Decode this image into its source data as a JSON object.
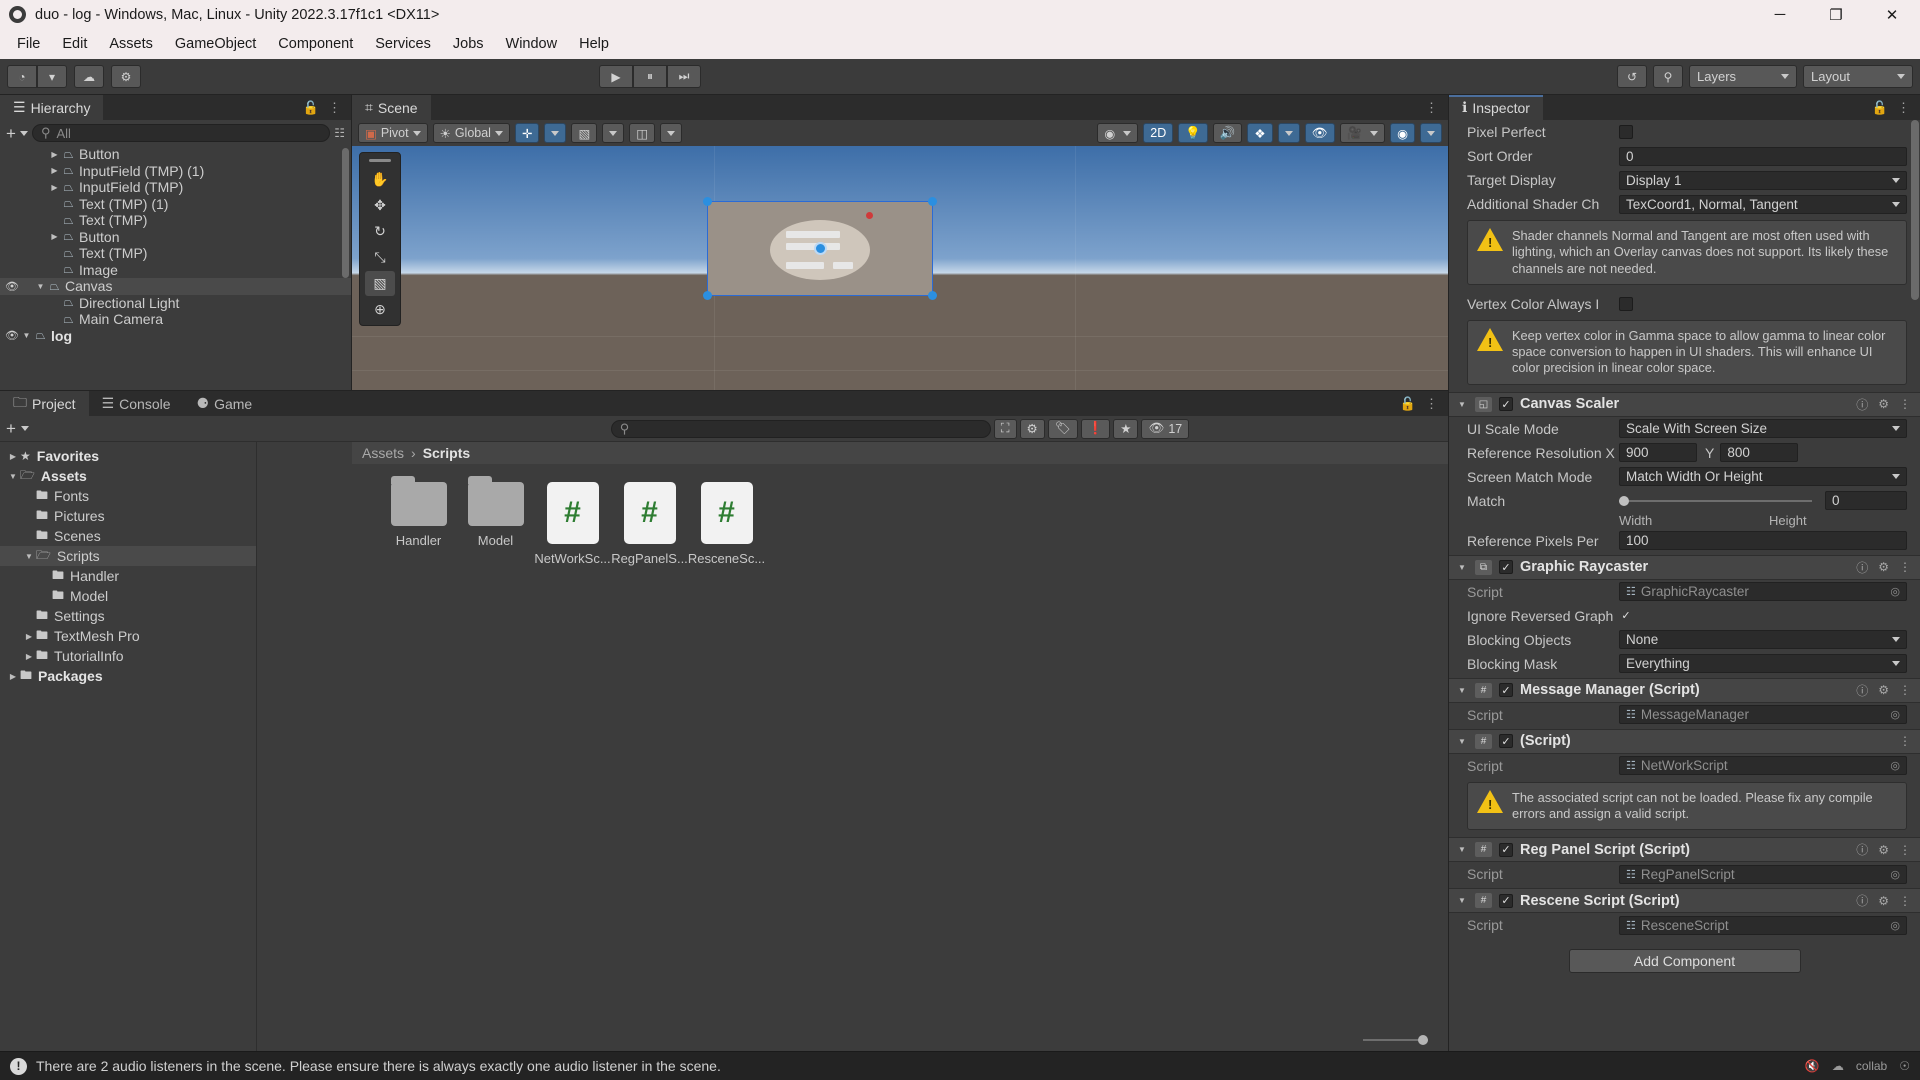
{
  "window": {
    "title": "duo - log - Windows, Mac, Linux - Unity 2022.3.17f1c1 <DX11>",
    "minimize": "─",
    "maximize": "❐",
    "close": "✕"
  },
  "menubar": {
    "items": [
      "File",
      "Edit",
      "Assets",
      "GameObject",
      "Component",
      "Services",
      "Jobs",
      "Window",
      "Help"
    ]
  },
  "toolbar": {
    "account_icon": "◔",
    "cloud_icon": "☁",
    "settings_icon": "⚙",
    "play": "▶",
    "pause": "⏸",
    "step": "⏭",
    "history_icon": "↺",
    "search_icon": "⚲",
    "layers_label": "Layers",
    "layout_label": "Layout"
  },
  "hierarchy": {
    "tab_label": "Hierarchy",
    "tab_icon": "☰",
    "search_placeholder": "All",
    "plus_label": "+",
    "items": [
      {
        "label": "log",
        "depth": 0,
        "expanded": true,
        "bold": true,
        "eye": true,
        "hasArrow": true,
        "selected": false
      },
      {
        "label": "Main Camera",
        "depth": 2,
        "expanded": false,
        "bold": false,
        "eye": false,
        "hasArrow": false,
        "selected": false
      },
      {
        "label": "Directional Light",
        "depth": 2,
        "expanded": false,
        "bold": false,
        "eye": false,
        "hasArrow": false,
        "selected": false
      },
      {
        "label": "Canvas",
        "depth": 1,
        "expanded": true,
        "bold": false,
        "eye": true,
        "hasArrow": true,
        "selected": true
      },
      {
        "label": "Image",
        "depth": 2,
        "expanded": false,
        "bold": false,
        "eye": false,
        "hasArrow": false,
        "selected": false
      },
      {
        "label": "Text (TMP)",
        "depth": 2,
        "expanded": false,
        "bold": false,
        "eye": false,
        "hasArrow": false,
        "selected": false
      },
      {
        "label": "Button",
        "depth": 2,
        "expanded": false,
        "bold": false,
        "eye": false,
        "hasArrow": true,
        "selected": false
      },
      {
        "label": "Text (TMP)",
        "depth": 2,
        "expanded": false,
        "bold": false,
        "eye": false,
        "hasArrow": false,
        "selected": false
      },
      {
        "label": "Text (TMP) (1)",
        "depth": 2,
        "expanded": false,
        "bold": false,
        "eye": false,
        "hasArrow": false,
        "selected": false
      },
      {
        "label": "InputField (TMP)",
        "depth": 2,
        "expanded": false,
        "bold": false,
        "eye": false,
        "hasArrow": true,
        "selected": false
      },
      {
        "label": "InputField (TMP) (1)",
        "depth": 2,
        "expanded": false,
        "bold": false,
        "eye": false,
        "hasArrow": true,
        "selected": false
      },
      {
        "label": "Button",
        "depth": 2,
        "expanded": false,
        "bold": false,
        "eye": false,
        "hasArrow": true,
        "selected": false
      }
    ]
  },
  "scene": {
    "tab_label": "Scene",
    "tab_icon": "⌗",
    "pivot_label": "Pivot",
    "global_label": "Global",
    "mode_2d": "2D",
    "toolbuttons": [
      "☷",
      "⌗",
      "≡"
    ],
    "tools": [
      "✋",
      "✥",
      "↻",
      "⤡",
      "▧",
      "⊕"
    ]
  },
  "project": {
    "tabs": [
      {
        "label": "Project",
        "icon": "🗀",
        "active": true
      },
      {
        "label": "Console",
        "icon": "☰",
        "active": false
      },
      {
        "label": "Game",
        "icon": "⚈",
        "active": false
      }
    ],
    "breadcrumb": {
      "root": "Assets",
      "sep": "›",
      "current": "Scripts"
    },
    "search_placeholder": "",
    "counter_badge": "17",
    "tree": [
      {
        "label": "Favorites",
        "depth": 0,
        "icon": "★",
        "arrow": "collapsed",
        "bold": true,
        "selected": false
      },
      {
        "label": "Assets",
        "depth": 0,
        "icon": "🗁",
        "arrow": "expanded",
        "bold": true,
        "selected": false
      },
      {
        "label": "Fonts",
        "depth": 1,
        "icon": "🖿",
        "arrow": "none",
        "bold": false,
        "selected": false
      },
      {
        "label": "Pictures",
        "depth": 1,
        "icon": "🖿",
        "arrow": "none",
        "bold": false,
        "selected": false
      },
      {
        "label": "Scenes",
        "depth": 1,
        "icon": "🖿",
        "arrow": "none",
        "bold": false,
        "selected": false
      },
      {
        "label": "Scripts",
        "depth": 1,
        "icon": "🗁",
        "arrow": "expanded",
        "bold": false,
        "selected": true
      },
      {
        "label": "Handler",
        "depth": 2,
        "icon": "🖿",
        "arrow": "none",
        "bold": false,
        "selected": false
      },
      {
        "label": "Model",
        "depth": 2,
        "icon": "🖿",
        "arrow": "none",
        "bold": false,
        "selected": false
      },
      {
        "label": "Settings",
        "depth": 1,
        "icon": "🖿",
        "arrow": "none",
        "bold": false,
        "selected": false
      },
      {
        "label": "TextMesh Pro",
        "depth": 1,
        "icon": "🖿",
        "arrow": "collapsed",
        "bold": false,
        "selected": false
      },
      {
        "label": "TutorialInfo",
        "depth": 1,
        "icon": "🖿",
        "arrow": "collapsed",
        "bold": false,
        "selected": false
      },
      {
        "label": "Packages",
        "depth": 0,
        "icon": "🖿",
        "arrow": "collapsed",
        "bold": true,
        "selected": false
      }
    ],
    "assets": [
      {
        "name": "Handler",
        "type": "folder"
      },
      {
        "name": "Model",
        "type": "folder"
      },
      {
        "name": "NetWorkSc...",
        "type": "script",
        "glyph": "#"
      },
      {
        "name": "RegPanelS...",
        "type": "script",
        "glyph": "#"
      },
      {
        "name": "ResceneSc...",
        "type": "script",
        "glyph": "#"
      }
    ]
  },
  "inspector": {
    "tab_label": "Inspector",
    "tab_icon": "ℹ",
    "canvas_fields": [
      {
        "label": "Pixel Perfect",
        "value": "",
        "kind": "partial"
      },
      {
        "label": "Sort Order",
        "value": "0",
        "kind": "text"
      },
      {
        "label": "Target Display",
        "value": "Display 1",
        "kind": "dropdown"
      },
      {
        "label": "Additional Shader Ch",
        "value": "TexCoord1, Normal, Tangent",
        "kind": "dropdown"
      }
    ],
    "warning_1": "Shader channels Normal and Tangent are most often used with lighting, which an Overlay canvas does not support. Its likely these channels are not needed.",
    "vertex_color_label": "Vertex Color Always I",
    "warning_2": "Keep vertex color in Gamma space to allow gamma to linear color space conversion to happen in UI shaders. This will enhance UI color precision in linear color space.",
    "components": [
      {
        "title": "Canvas Scaler",
        "icon": "◱",
        "checked": true,
        "has_help": true,
        "rows": [
          {
            "label": "UI Scale Mode",
            "value": "Scale With Screen Size",
            "kind": "dropdown"
          },
          {
            "label": "Reference Resolution X",
            "value": "900",
            "kind": "xy",
            "y_label": "Y",
            "y_value": "800"
          },
          {
            "label": "Screen Match Mode",
            "value": "Match Width Or Height",
            "kind": "dropdown"
          },
          {
            "label": "Match",
            "value": "0",
            "kind": "slider",
            "width_label": "Width",
            "height_label": "Height"
          },
          {
            "label": "Reference Pixels Per",
            "value": "100",
            "kind": "text"
          }
        ]
      },
      {
        "title": "Graphic Raycaster",
        "icon": "⧉",
        "checked": true,
        "has_help": true,
        "rows": [
          {
            "label": "Script",
            "value": "GraphicRaycaster",
            "kind": "object"
          },
          {
            "label": "Ignore Reversed Graph",
            "value": "",
            "kind": "checkbox",
            "checked": true
          },
          {
            "label": "Blocking Objects",
            "value": "None",
            "kind": "dropdown"
          },
          {
            "label": "Blocking Mask",
            "value": "Everything",
            "kind": "dropdown"
          }
        ]
      },
      {
        "title": "Message Manager (Script)",
        "icon": "#",
        "checked": true,
        "has_help": true,
        "rows": [
          {
            "label": "Script",
            "value": "MessageManager",
            "kind": "object"
          }
        ]
      },
      {
        "title": "(Script)",
        "icon": "#",
        "checked": true,
        "has_help": false,
        "rows": [
          {
            "label": "Script",
            "value": "NetWorkScript",
            "kind": "object"
          }
        ],
        "warning": "The associated script can not be loaded. Please fix any compile errors and assign a valid script."
      },
      {
        "title": "Reg Panel Script (Script)",
        "icon": "#",
        "checked": true,
        "has_help": true,
        "rows": [
          {
            "label": "Script",
            "value": "RegPanelScript",
            "kind": "object"
          }
        ]
      },
      {
        "title": "Rescene Script (Script)",
        "icon": "#",
        "checked": true,
        "has_help": true,
        "rows": [
          {
            "label": "Script",
            "value": "ResceneScript",
            "kind": "object"
          }
        ]
      }
    ],
    "add_component_label": "Add Component"
  },
  "statusbar": {
    "message": "There are 2 audio listeners in the scene. Please ensure there is always exactly one audio listener in the scene.",
    "error_glyph": "!"
  }
}
